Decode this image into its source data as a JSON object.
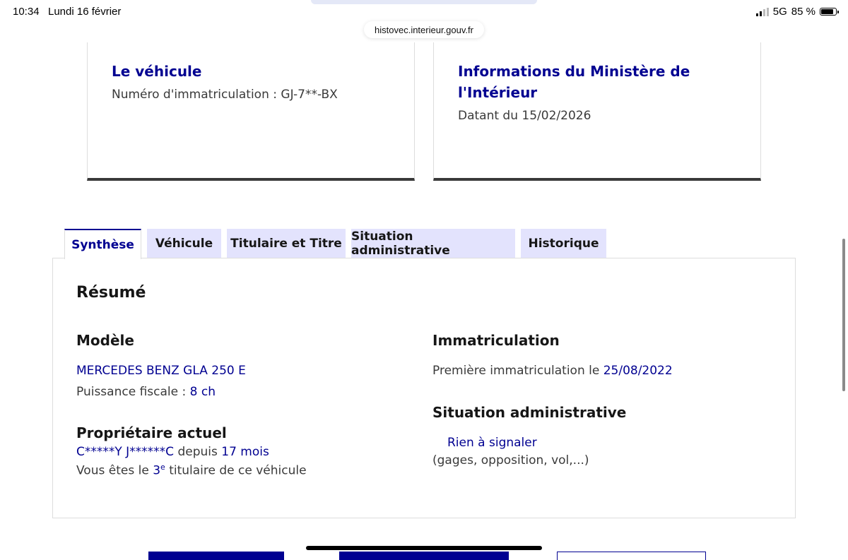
{
  "status_bar": {
    "time": "10:34",
    "date": "Lundi 16 février",
    "network": "5G",
    "battery": "85 %",
    "battery_level": 0.85
  },
  "browser": {
    "url": "histovec.interieur.gouv.fr"
  },
  "cards": {
    "vehicle": {
      "title": "Le véhicule",
      "desc_label": "Numéro d'immatriculation : ",
      "desc_value": "GJ-7**-BX"
    },
    "ministry": {
      "title_line1": "Informations du Ministère de",
      "title_line2": "l'Intérieur",
      "desc_label": "Datant du ",
      "desc_value": "15/02/2026"
    }
  },
  "tabs": [
    {
      "label": "Synthèse",
      "active": true
    },
    {
      "label": "Véhicule",
      "active": false
    },
    {
      "label": "Titulaire et Titre",
      "active": false
    },
    {
      "label": "Situation administrative",
      "active": false
    },
    {
      "label": "Historique",
      "active": false
    }
  ],
  "summary": {
    "heading": "Résumé",
    "model": {
      "heading": "Modèle",
      "name": "MERCEDES BENZ GLA 250 E",
      "power_label": "Puissance fiscale : ",
      "power_value": "8 ch"
    },
    "owner": {
      "heading": "Propriétaire actuel",
      "name": "C*****Y J******C",
      "since_label": " depuis ",
      "since_value": "17 mois",
      "rank_prefix": "Vous êtes le ",
      "rank_number": "3",
      "rank_sup": "e",
      "rank_suffix": " titulaire de ce véhicule"
    },
    "registration": {
      "heading": "Immatriculation",
      "first_label": "Première immatriculation le ",
      "first_value": "25/08/2022"
    },
    "admin": {
      "heading": "Situation administrative",
      "status": "Rien à signaler",
      "detail": "(gages, opposition, vol,...)"
    }
  },
  "colors": {
    "primary": "#000091",
    "tab_bg": "#e3e3fd",
    "text": "#161616",
    "muted": "#3a3a3a"
  }
}
